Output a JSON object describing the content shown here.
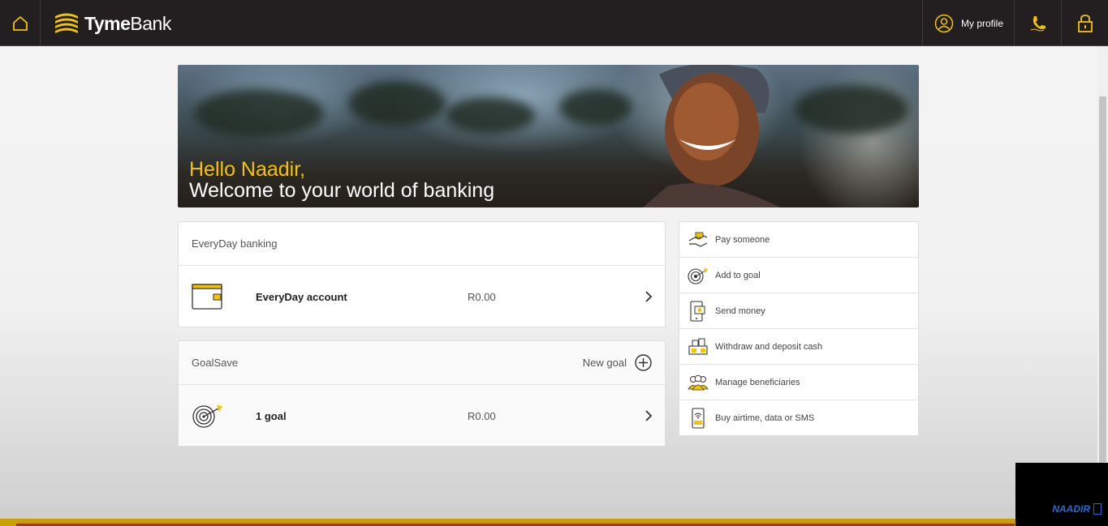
{
  "header": {
    "brand_bold": "Tyme",
    "brand_light": "Bank",
    "profile_label": "My profile",
    "icons": [
      "home-icon",
      "tymebank-logo",
      "profile-icon",
      "phone-icon",
      "lock-icon"
    ]
  },
  "hero": {
    "greeting": "Hello Naadir,",
    "welcome": "Welcome to your world of banking"
  },
  "everyday": {
    "heading": "EveryDay banking",
    "account_name": "EveryDay account",
    "balance": "R0.00"
  },
  "goalsave": {
    "heading": "GoalSave",
    "new_goal_label": "New goal",
    "goal_count": "1 goal",
    "balance": "R0.00"
  },
  "actions": [
    {
      "label": "Pay someone",
      "icon": "pay-someone-icon"
    },
    {
      "label": "Add to goal",
      "icon": "add-to-goal-icon"
    },
    {
      "label": "Send money",
      "icon": "send-money-icon"
    },
    {
      "label": "Withdraw and deposit cash",
      "icon": "withdraw-deposit-icon"
    },
    {
      "label": "Manage beneficiaries",
      "icon": "beneficiaries-icon"
    },
    {
      "label": "Buy airtime, data or SMS",
      "icon": "airtime-icon"
    }
  ],
  "watermark": {
    "text": "NAADIR"
  },
  "colors": {
    "brand_yellow": "#f5c400",
    "header_bg": "#231f20"
  }
}
